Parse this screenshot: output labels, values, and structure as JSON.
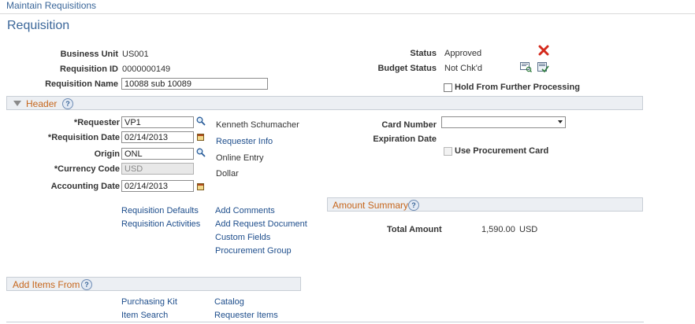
{
  "breadcrumb": "Maintain Requisitions",
  "page_title": "Requisition",
  "requisition": {
    "business_unit_label": "Business Unit",
    "business_unit_value": "US001",
    "requisition_id_label": "Requisition ID",
    "requisition_id_value": "0000000149",
    "requisition_name_label": "Requisition Name",
    "requisition_name_value": "10088 sub 10089",
    "status_label": "Status",
    "status_value": "Approved",
    "budget_status_label": "Budget Status",
    "budget_status_value": "Not Chk'd",
    "hold_label": "Hold From Further Processing"
  },
  "header_section": {
    "title": "Header",
    "requester_label": "*Requester",
    "requester_value": "VP1",
    "requester_name": "Kenneth Schumacher",
    "requisition_date_label": "*Requisition Date",
    "requisition_date_value": "02/14/2013",
    "requester_info_link": "Requester Info",
    "origin_label": "Origin",
    "origin_value": "ONL",
    "origin_desc": "Online Entry",
    "currency_label": "*Currency Code",
    "currency_value": "USD",
    "currency_desc": "Dollar",
    "accounting_date_label": "Accounting Date",
    "accounting_date_value": "02/14/2013",
    "card_number_label": "Card Number",
    "card_number_value": "",
    "expiration_date_label": "Expiration Date",
    "use_card_label": "Use Procurement Card",
    "links": {
      "requisition_defaults": "Requisition Defaults",
      "requisition_activities": "Requisition Activities",
      "add_comments": "Add Comments",
      "add_request_document": "Add Request Document",
      "custom_fields": "Custom Fields",
      "procurement_group": "Procurement Group"
    }
  },
  "amount_summary": {
    "title": "Amount Summary",
    "total_amount_label": "Total Amount",
    "total_amount_value": "1,590.00",
    "currency": "USD"
  },
  "add_items": {
    "title": "Add Items From",
    "purchasing_kit": "Purchasing Kit",
    "catalog": "Catalog",
    "item_search": "Item Search",
    "requester_items": "Requester Items"
  },
  "help_glyph": "?",
  "colors": {
    "link": "#1e4e8c",
    "section_title": "#c6661c",
    "title": "#3a6699",
    "delete_icon": "#d42a1c"
  }
}
